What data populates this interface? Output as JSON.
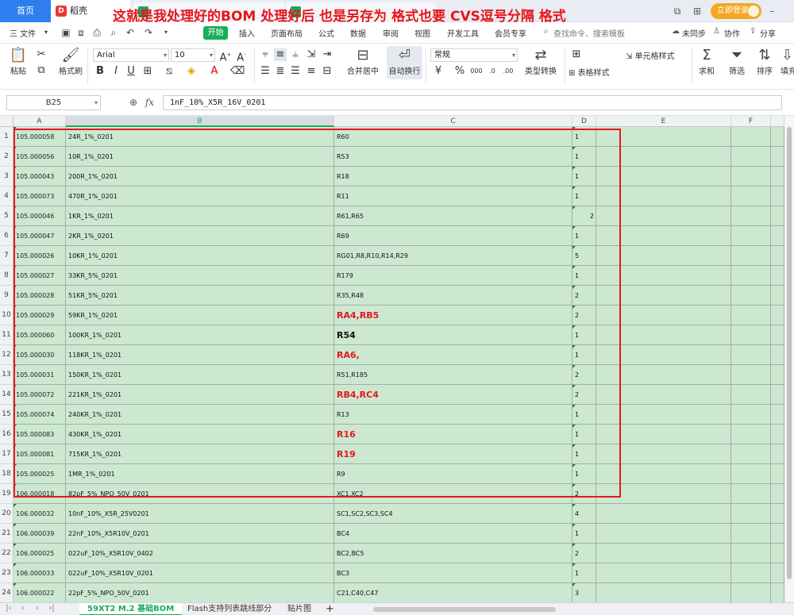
{
  "titlebar": {
    "home_tab": "首页",
    "doc_tab": "稻壳",
    "annotation": "这就是我处理好的BOM  处理好后 也是另存为 格式也要  CVS逗号分隔   格式",
    "login_button": "立即登录"
  },
  "menubar": {
    "file_menu": "三 文件",
    "start_tab": "开始",
    "items": [
      "插入",
      "页面布局",
      "公式",
      "数据",
      "审阅",
      "视图",
      "开发工具",
      "会员专享"
    ],
    "search_placeholder": "查找命令、搜索模板",
    "right_items": [
      "未同步",
      "协作",
      "分享"
    ]
  },
  "ribbon": {
    "paste": "粘贴",
    "format_painter": "格式刷",
    "font_name": "Arial",
    "font_size": "10",
    "merge_center": "合并居中",
    "wrap_text": "自动换行",
    "number_format": "常规",
    "type_convert": "类型转换",
    "table_style": "表格样式",
    "cell_style": "单元格样式",
    "sum": "求和",
    "filter": "筛选",
    "sort": "排序",
    "fill": "填充"
  },
  "formulabar": {
    "cell_ref": "B25",
    "fx": "fx",
    "formula": "1nF_10%_X5R_16V_0201"
  },
  "columns": [
    "A",
    "B",
    "C",
    "D",
    "E",
    "F"
  ],
  "rows": [
    {
      "num": "1",
      "a": "105.000058",
      "b": "24R_1%_0201",
      "c": "R60",
      "d": "1",
      "style": ""
    },
    {
      "num": "2",
      "a": "105.000056",
      "b": "10R_1%_0201",
      "c": "R53",
      "d": "1",
      "style": ""
    },
    {
      "num": "3",
      "a": "105.000043",
      "b": "200R_1%_0201",
      "c": "R18",
      "d": "1",
      "style": ""
    },
    {
      "num": "4",
      "a": "105.000073",
      "b": "470R_1%_0201",
      "c": "R11",
      "d": "1",
      "style": ""
    },
    {
      "num": "5",
      "a": "105.000046",
      "b": "1KR_1%_0201",
      "c": "R61,R65",
      "d": "2",
      "style": "dright"
    },
    {
      "num": "6",
      "a": "105.000047",
      "b": "2KR_1%_0201",
      "c": "R69",
      "d": "1",
      "style": ""
    },
    {
      "num": "7",
      "a": "105.000026",
      "b": "10KR_1%_0201",
      "c": "RG01,R8,R10,R14,R29",
      "d": "5",
      "style": ""
    },
    {
      "num": "8",
      "a": "105.000027",
      "b": "33KR_5%_0201",
      "c": "R179",
      "d": "1",
      "style": ""
    },
    {
      "num": "9",
      "a": "105.000028",
      "b": "51KR_5%_0201",
      "c": "R35,R48",
      "d": "2",
      "style": ""
    },
    {
      "num": "10",
      "a": "105.000029",
      "b": "59KR_1%_0201",
      "c": "RA4,RB5",
      "d": "2",
      "style": "red"
    },
    {
      "num": "11",
      "a": "105.000060",
      "b": "100KR_1%_0201",
      "c": "R54",
      "d": "1",
      "style": "black"
    },
    {
      "num": "12",
      "a": "105.000030",
      "b": "118KR_1%_0201",
      "c": "RA6,",
      "d": "1",
      "style": "red"
    },
    {
      "num": "13",
      "a": "105.000031",
      "b": "150KR_1%_0201",
      "c": "R51,R185",
      "d": "2",
      "style": ""
    },
    {
      "num": "14",
      "a": "105.000072",
      "b": "221KR_1%_0201",
      "c": "RB4,RC4",
      "d": "2",
      "style": "red"
    },
    {
      "num": "15",
      "a": "105.000074",
      "b": "240KR_1%_0201",
      "c": "R13",
      "d": "1",
      "style": ""
    },
    {
      "num": "16",
      "a": "105.000083",
      "b": "430KR_1%_0201",
      "c": "R16",
      "d": "1",
      "style": "red"
    },
    {
      "num": "17",
      "a": "105.000081",
      "b": "715KR_1%_0201",
      "c": "R19",
      "d": "1",
      "style": "red"
    },
    {
      "num": "18",
      "a": "105.000025",
      "b": "1MR_1%_0201",
      "c": "R9",
      "d": "1",
      "style": ""
    },
    {
      "num": "19",
      "a": "106.000018",
      "b": "82pF_5%_NPO_50V_0201",
      "c": "XC1,XC2",
      "d": "2",
      "style": ""
    },
    {
      "num": "20",
      "a": "106.000032",
      "b": "10nF_10%_X5R_25V0201",
      "c": "SC1,SC2,SC3,SC4",
      "d": "4",
      "style": ""
    },
    {
      "num": "21",
      "a": "106.000039",
      "b": "22nF_10%_X5R10V_0201",
      "c": "BC4",
      "d": "1",
      "style": ""
    },
    {
      "num": "22",
      "a": "106.000025",
      "b": "022uF_10%_X5R10V_0402",
      "c": "BC2,BC5",
      "d": "2",
      "style": ""
    },
    {
      "num": "23",
      "a": "106.000033",
      "b": "022uF_10%_X5R10V_0201",
      "c": "BC3",
      "d": "1",
      "style": ""
    },
    {
      "num": "24",
      "a": "106.000022",
      "b": "22pF_5%_NPO_50V_0201",
      "c": "C21,C40,C47",
      "d": "3",
      "style": ""
    }
  ],
  "sheets": {
    "tabs": [
      "59XT2 M.2 基础BOM",
      "Flash支持列表跳线部分",
      "贴片图"
    ],
    "add": "+"
  }
}
